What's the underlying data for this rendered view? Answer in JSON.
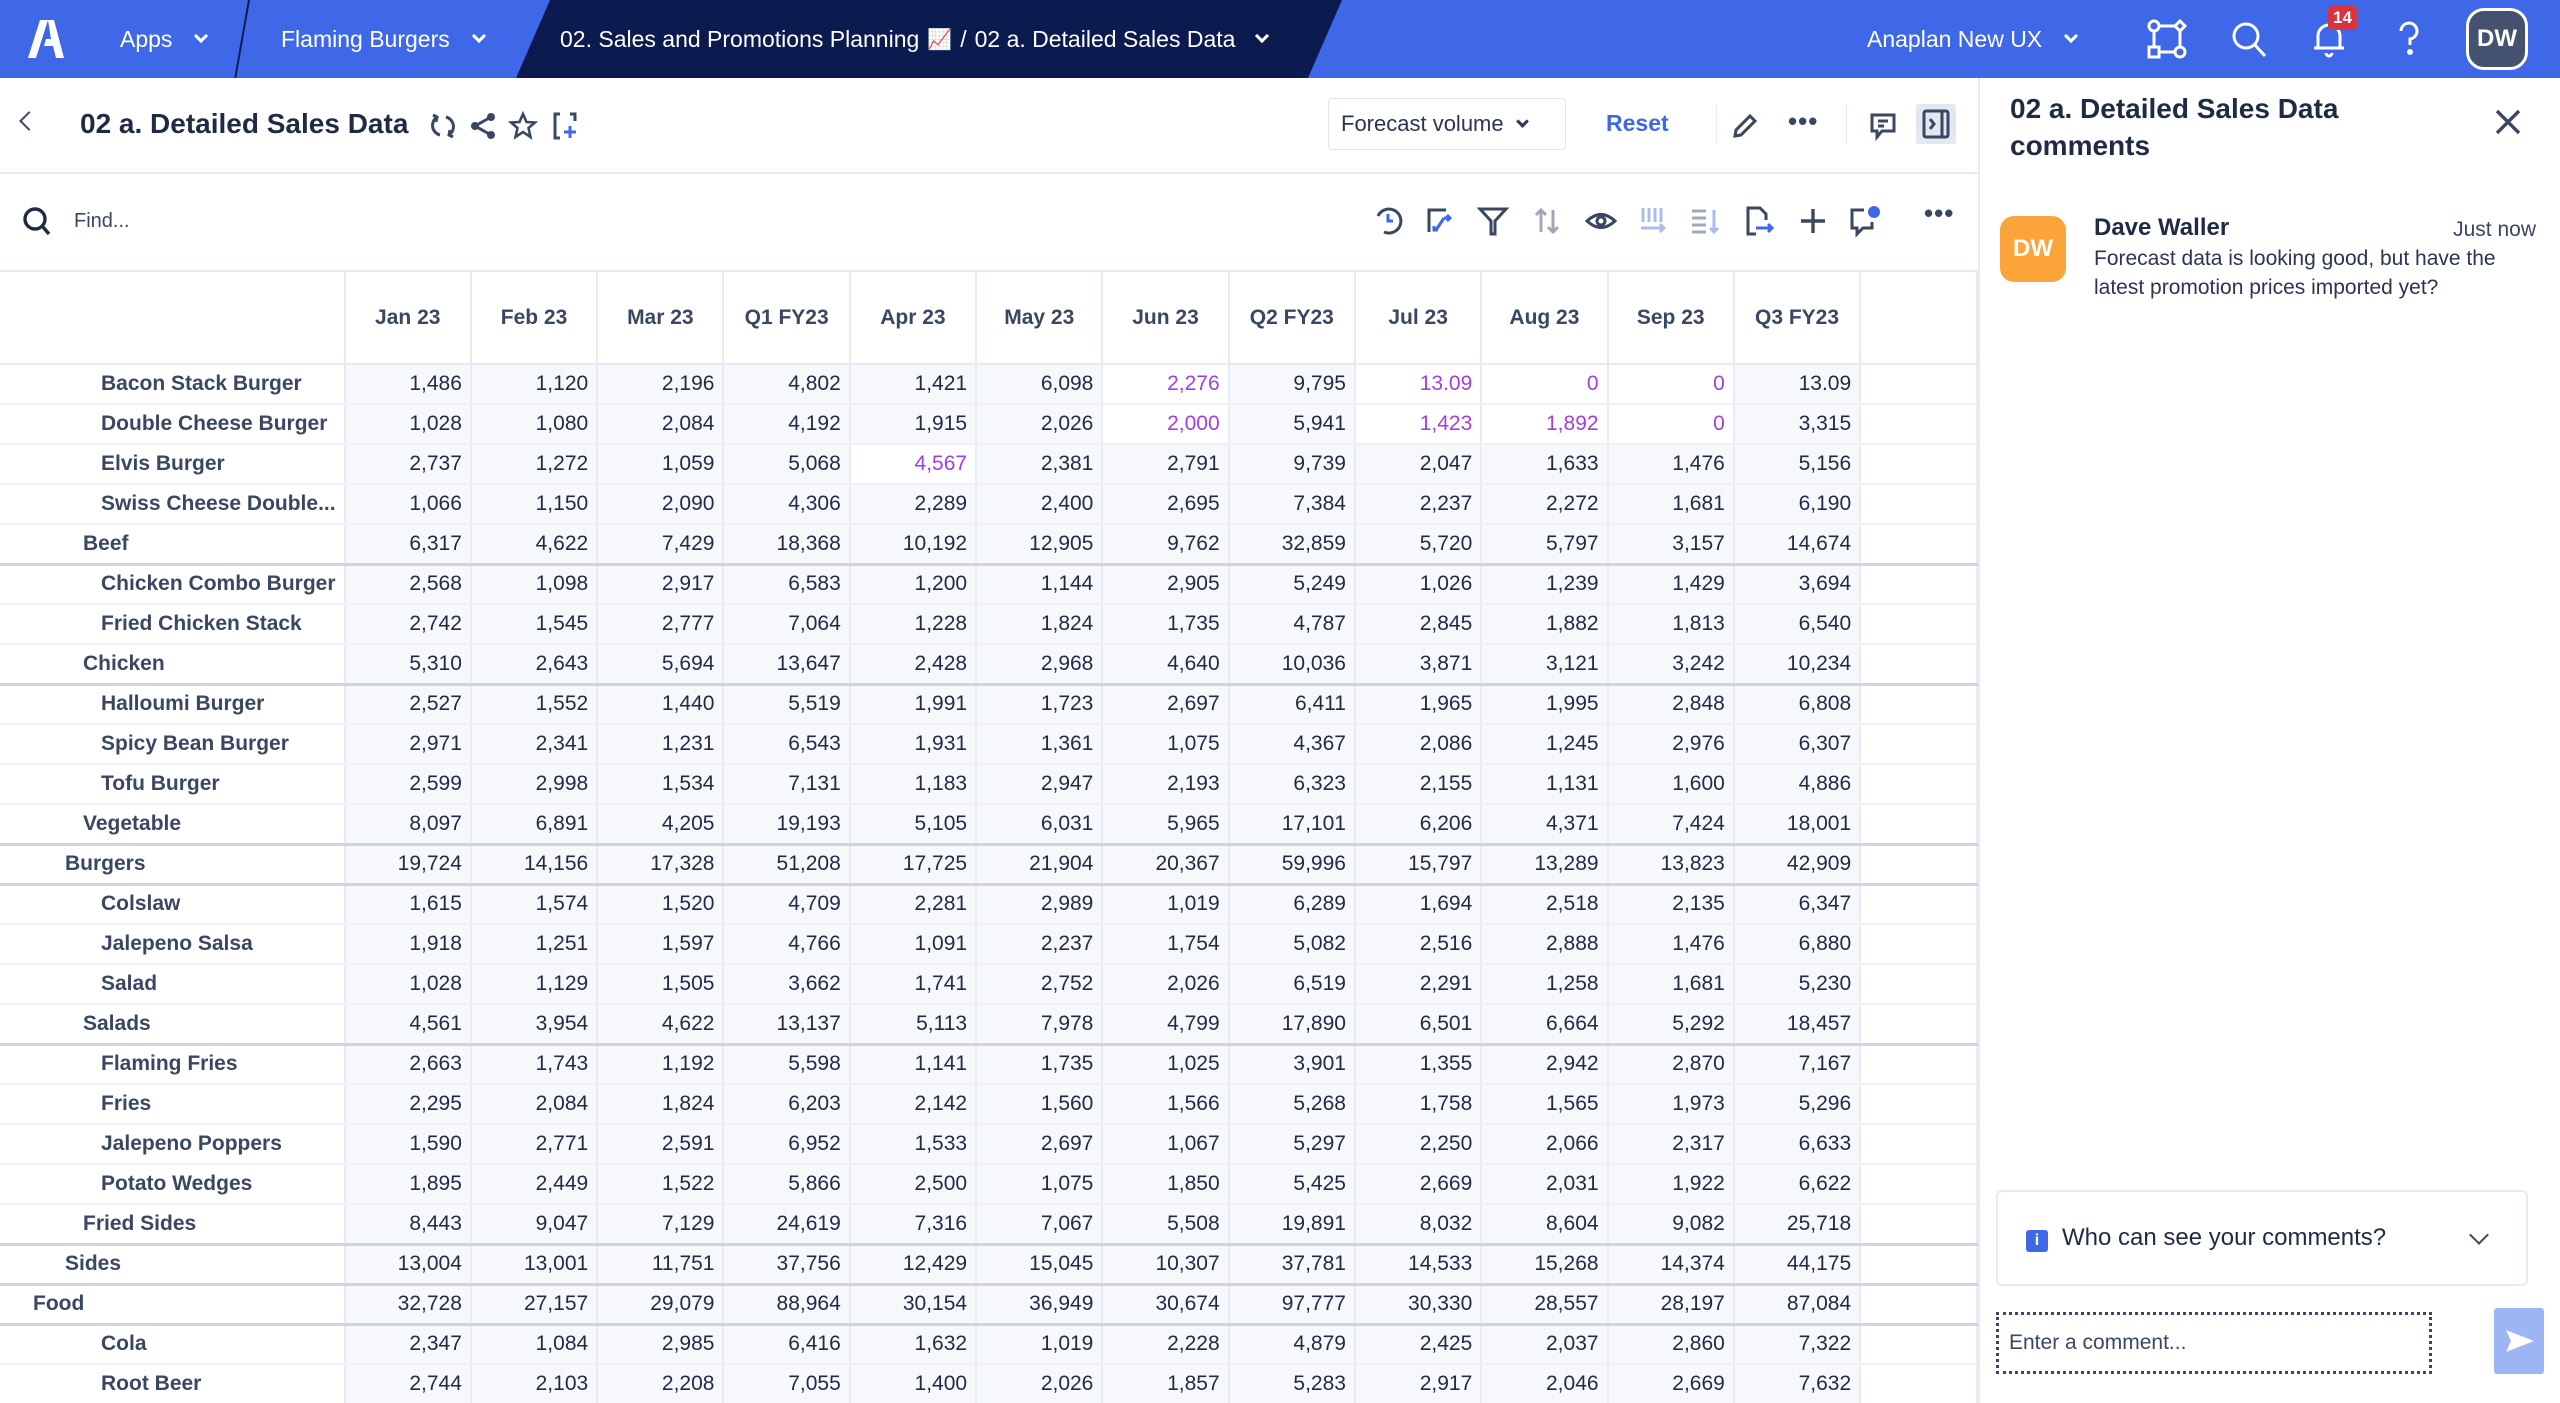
{
  "topbar": {
    "apps_label": "Apps",
    "workspace_label": "Flaming Burgers",
    "breadcrumb_model": "02. Sales and Promotions Planning",
    "breadcrumb_emoji": "📈",
    "breadcrumb_separator": "/",
    "breadcrumb_page": "02 a. Detailed Sales Data",
    "tenant_label": "Anaplan New UX",
    "notifications_count": "14",
    "user_initials": "DW",
    "icons": [
      "anaplan-logo-icon",
      "model-graph-icon",
      "search-icon",
      "bell-icon",
      "help-icon"
    ]
  },
  "page": {
    "title": "02 a. Detailed Sales Data",
    "icons": [
      "refresh-icon",
      "share-icon",
      "star-icon",
      "add-to-page-icon"
    ],
    "view_dropdown": "Forecast volume",
    "reset_label": "Reset"
  },
  "toolbar": {
    "find_placeholder": "Find...",
    "tools": [
      "history-icon",
      "pivot-icon",
      "filter-icon",
      "sort-icon",
      "show-hide-icon",
      "column-icon",
      "row-sort-icon",
      "export-icon",
      "add-icon",
      "cell-comment-icon",
      "more-icon"
    ]
  },
  "grid": {
    "columns": [
      "Jan 23",
      "Feb 23",
      "Mar 23",
      "Q1 FY23",
      "Apr 23",
      "May 23",
      "Jun 23",
      "Q2 FY23",
      "Jul 23",
      "Aug 23",
      "Sep 23",
      "Q3 FY23"
    ],
    "rows": [
      {
        "label": "Bacon Stack Burger",
        "level": 3,
        "values": [
          "1,486",
          "1,120",
          "2,196",
          "4,802",
          "1,421",
          "6,098",
          "2,276",
          "9,795",
          "13.09",
          "0",
          "0",
          "13.09"
        ],
        "edited": [
          6,
          8,
          9,
          10
        ]
      },
      {
        "label": "Double Cheese Burger",
        "level": 3,
        "values": [
          "1,028",
          "1,080",
          "2,084",
          "4,192",
          "1,915",
          "2,026",
          "2,000",
          "5,941",
          "1,423",
          "1,892",
          "0",
          "3,315"
        ],
        "edited": [
          6,
          8,
          9,
          10
        ]
      },
      {
        "label": "Elvis Burger",
        "level": 3,
        "values": [
          "2,737",
          "1,272",
          "1,059",
          "5,068",
          "4,567",
          "2,381",
          "2,791",
          "9,739",
          "2,047",
          "1,633",
          "1,476",
          "5,156"
        ],
        "edited": [
          4
        ]
      },
      {
        "label": "Swiss Cheese Double...",
        "level": 3,
        "values": [
          "1,066",
          "1,150",
          "2,090",
          "4,306",
          "2,289",
          "2,400",
          "2,695",
          "7,384",
          "2,237",
          "2,272",
          "1,681",
          "6,190"
        ],
        "edited": []
      },
      {
        "label": "Beef",
        "level": 2,
        "subtotal": true,
        "values": [
          "6,317",
          "4,622",
          "7,429",
          "18,368",
          "10,192",
          "12,905",
          "9,762",
          "32,859",
          "5,720",
          "5,797",
          "3,157",
          "14,674"
        ],
        "edited": []
      },
      {
        "label": "Chicken Combo Burger",
        "level": 3,
        "values": [
          "2,568",
          "1,098",
          "2,917",
          "6,583",
          "1,200",
          "1,144",
          "2,905",
          "5,249",
          "1,026",
          "1,239",
          "1,429",
          "3,694"
        ],
        "edited": []
      },
      {
        "label": "Fried Chicken Stack",
        "level": 3,
        "values": [
          "2,742",
          "1,545",
          "2,777",
          "7,064",
          "1,228",
          "1,824",
          "1,735",
          "4,787",
          "2,845",
          "1,882",
          "1,813",
          "6,540"
        ],
        "edited": []
      },
      {
        "label": "Chicken",
        "level": 2,
        "subtotal": true,
        "values": [
          "5,310",
          "2,643",
          "5,694",
          "13,647",
          "2,428",
          "2,968",
          "4,640",
          "10,036",
          "3,871",
          "3,121",
          "3,242",
          "10,234"
        ],
        "edited": []
      },
      {
        "label": "Halloumi Burger",
        "level": 3,
        "values": [
          "2,527",
          "1,552",
          "1,440",
          "5,519",
          "1,991",
          "1,723",
          "2,697",
          "6,411",
          "1,965",
          "1,995",
          "2,848",
          "6,808"
        ],
        "edited": []
      },
      {
        "label": "Spicy Bean Burger",
        "level": 3,
        "values": [
          "2,971",
          "2,341",
          "1,231",
          "6,543",
          "1,931",
          "1,361",
          "1,075",
          "4,367",
          "2,086",
          "1,245",
          "2,976",
          "6,307"
        ],
        "edited": []
      },
      {
        "label": "Tofu Burger",
        "level": 3,
        "values": [
          "2,599",
          "2,998",
          "1,534",
          "7,131",
          "1,183",
          "2,947",
          "2,193",
          "6,323",
          "2,155",
          "1,131",
          "1,600",
          "4,886"
        ],
        "edited": []
      },
      {
        "label": "Vegetable",
        "level": 2,
        "subtotal": true,
        "values": [
          "8,097",
          "6,891",
          "4,205",
          "19,193",
          "5,105",
          "6,031",
          "5,965",
          "17,101",
          "6,206",
          "4,371",
          "7,424",
          "18,001"
        ],
        "edited": []
      },
      {
        "label": "Burgers",
        "level": 1,
        "subtotal": true,
        "values": [
          "19,724",
          "14,156",
          "17,328",
          "51,208",
          "17,725",
          "21,904",
          "20,367",
          "59,996",
          "15,797",
          "13,289",
          "13,823",
          "42,909"
        ],
        "edited": []
      },
      {
        "label": "Colslaw",
        "level": 3,
        "values": [
          "1,615",
          "1,574",
          "1,520",
          "4,709",
          "2,281",
          "2,989",
          "1,019",
          "6,289",
          "1,694",
          "2,518",
          "2,135",
          "6,347"
        ],
        "edited": []
      },
      {
        "label": "Jalepeno Salsa",
        "level": 3,
        "values": [
          "1,918",
          "1,251",
          "1,597",
          "4,766",
          "1,091",
          "2,237",
          "1,754",
          "5,082",
          "2,516",
          "2,888",
          "1,476",
          "6,880"
        ],
        "edited": []
      },
      {
        "label": "Salad",
        "level": 3,
        "values": [
          "1,028",
          "1,129",
          "1,505",
          "3,662",
          "1,741",
          "2,752",
          "2,026",
          "6,519",
          "2,291",
          "1,258",
          "1,681",
          "5,230"
        ],
        "edited": []
      },
      {
        "label": "Salads",
        "level": 2,
        "subtotal": true,
        "values": [
          "4,561",
          "3,954",
          "4,622",
          "13,137",
          "5,113",
          "7,978",
          "4,799",
          "17,890",
          "6,501",
          "6,664",
          "5,292",
          "18,457"
        ],
        "edited": []
      },
      {
        "label": "Flaming Fries",
        "level": 3,
        "values": [
          "2,663",
          "1,743",
          "1,192",
          "5,598",
          "1,141",
          "1,735",
          "1,025",
          "3,901",
          "1,355",
          "2,942",
          "2,870",
          "7,167"
        ],
        "edited": []
      },
      {
        "label": "Fries",
        "level": 3,
        "values": [
          "2,295",
          "2,084",
          "1,824",
          "6,203",
          "2,142",
          "1,560",
          "1,566",
          "5,268",
          "1,758",
          "1,565",
          "1,973",
          "5,296"
        ],
        "edited": []
      },
      {
        "label": "Jalepeno Poppers",
        "level": 3,
        "values": [
          "1,590",
          "2,771",
          "2,591",
          "6,952",
          "1,533",
          "2,697",
          "1,067",
          "5,297",
          "2,250",
          "2,066",
          "2,317",
          "6,633"
        ],
        "edited": []
      },
      {
        "label": "Potato Wedges",
        "level": 3,
        "values": [
          "1,895",
          "2,449",
          "1,522",
          "5,866",
          "2,500",
          "1,075",
          "1,850",
          "5,425",
          "2,669",
          "2,031",
          "1,922",
          "6,622"
        ],
        "edited": []
      },
      {
        "label": "Fried Sides",
        "level": 2,
        "subtotal": true,
        "values": [
          "8,443",
          "9,047",
          "7,129",
          "24,619",
          "7,316",
          "7,067",
          "5,508",
          "19,891",
          "8,032",
          "8,604",
          "9,082",
          "25,718"
        ],
        "edited": []
      },
      {
        "label": "Sides",
        "level": 1,
        "subtotal": true,
        "values": [
          "13,004",
          "13,001",
          "11,751",
          "37,756",
          "12,429",
          "15,045",
          "10,307",
          "37,781",
          "14,533",
          "15,268",
          "14,374",
          "44,175"
        ],
        "edited": []
      },
      {
        "label": "Food",
        "level": 0,
        "subtotal": true,
        "values": [
          "32,728",
          "27,157",
          "29,079",
          "88,964",
          "30,154",
          "36,949",
          "30,674",
          "97,777",
          "30,330",
          "28,557",
          "28,197",
          "87,084"
        ],
        "edited": []
      },
      {
        "label": "Cola",
        "level": 3,
        "values": [
          "2,347",
          "1,084",
          "2,985",
          "6,416",
          "1,632",
          "1,019",
          "2,228",
          "4,879",
          "2,425",
          "2,037",
          "2,860",
          "7,322"
        ],
        "edited": []
      },
      {
        "label": "Root Beer",
        "level": 3,
        "values": [
          "2,744",
          "2,103",
          "2,208",
          "7,055",
          "1,400",
          "2,026",
          "1,857",
          "5,283",
          "2,917",
          "2,046",
          "2,669",
          "7,632"
        ],
        "edited": []
      }
    ]
  },
  "comments": {
    "title": "02 a. Detailed Sales Data comments",
    "items": [
      {
        "initials": "DW",
        "author": "Dave Waller",
        "time": "Just now",
        "text": "Forecast data is looking good, but have the latest promotion prices imported yet?"
      }
    ],
    "visibility_label": "Who can see your comments?",
    "input_placeholder": "Enter a comment..."
  },
  "colors": {
    "brand_blue": "#3e68e8",
    "navy": "#0b1b50",
    "edited_value": "#a23ee0",
    "avatar_orange": "#fba43a",
    "notification_red": "#d9333f"
  }
}
